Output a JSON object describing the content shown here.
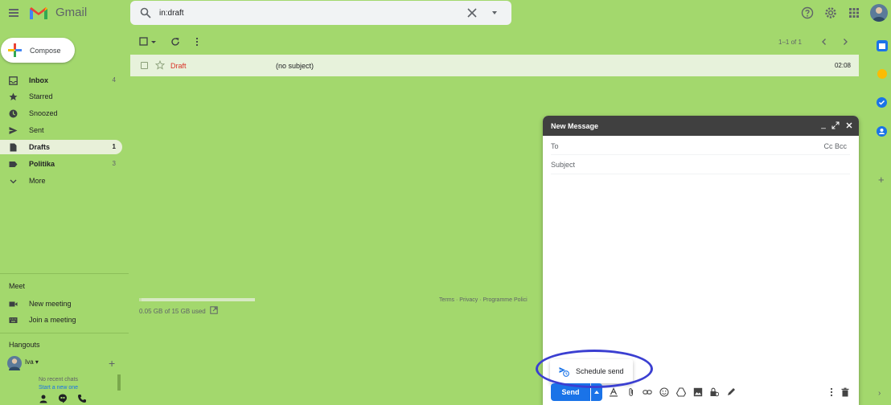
{
  "app": {
    "name": "Gmail"
  },
  "search": {
    "value": "in:draft"
  },
  "compose_button": {
    "label": "Compose"
  },
  "nav": {
    "items": [
      {
        "label": "Inbox",
        "count": "4",
        "icon": "inbox-icon"
      },
      {
        "label": "Starred",
        "count": "",
        "icon": "star-icon"
      },
      {
        "label": "Snoozed",
        "count": "",
        "icon": "clock-icon"
      },
      {
        "label": "Sent",
        "count": "",
        "icon": "send-icon"
      },
      {
        "label": "Drafts",
        "count": "1",
        "icon": "draft-icon"
      },
      {
        "label": "Politika",
        "count": "3",
        "icon": "label-icon"
      },
      {
        "label": "More",
        "count": "",
        "icon": "chevron-down-icon"
      }
    ]
  },
  "meet": {
    "title": "Meet",
    "new_meeting": "New meeting",
    "join_meeting": "Join a meeting"
  },
  "hangouts": {
    "title": "Hangouts",
    "user": "Iva",
    "no_chats": "No recent chats",
    "start_new": "Start a new one"
  },
  "toolbar": {
    "page_info": "1–1 of 1"
  },
  "draft_row": {
    "sender": "Draft",
    "subject": "(no subject)",
    "time": "02:08"
  },
  "storage": {
    "text": "0.05 GB of 15 GB used",
    "used_fraction": 0.0033
  },
  "footer": {
    "links": "Terms · Privacy · Programme Polici"
  },
  "compose_window": {
    "title": "New Message",
    "to_label": "To",
    "cc_bcc": "Cc Bcc",
    "subject_placeholder": "Subject",
    "send_label": "Send",
    "schedule_send": "Schedule send"
  },
  "colors": {
    "background": "#a3d86d",
    "accent_blue": "#1a73e8",
    "draft_red": "#d93025",
    "compose_header": "#404040",
    "highlight": "#3b3fd1"
  }
}
